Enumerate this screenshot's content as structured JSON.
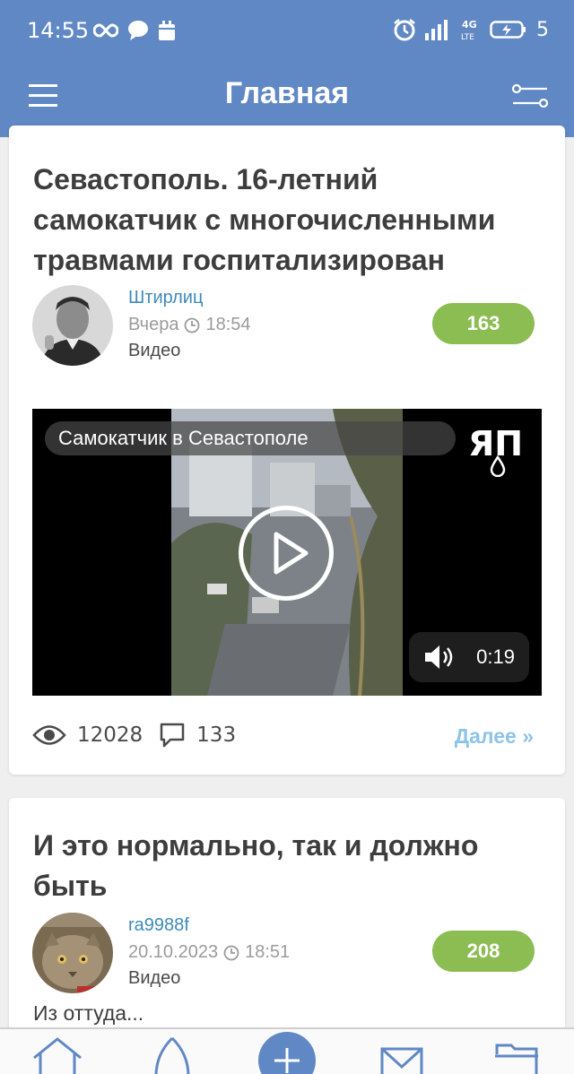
{
  "status_bar": {
    "time": "14:55",
    "network": "4G LTE",
    "battery": "5"
  },
  "app_bar": {
    "title": "Главная"
  },
  "posts": [
    {
      "title": "Севастополь. 16-летний самокатчик с многочисленными травмами госпитализирован",
      "author": "Штирлиц",
      "date": "Вчера",
      "time": "18:54",
      "type": "Видео",
      "rating": "163",
      "video": {
        "caption": "Самокатчик в Севастополе",
        "logo": "ЯП",
        "duration": "0:19"
      },
      "views": "12028",
      "comments": "133",
      "more": "Далее »"
    },
    {
      "title": "И это нормально, так и должно быть",
      "author": "ra9988f",
      "date": "20.10.2023",
      "time": "18:51",
      "type": "Видео",
      "rating": "208",
      "excerpt": "Из оттуда..."
    }
  ],
  "bottom_nav": {
    "items": [
      "home-icon",
      "egg-icon",
      "plus-icon",
      "mail-icon",
      "folder-icon"
    ]
  },
  "colors": {
    "primary": "#5f88c5",
    "rating": "#8cbd52",
    "link": "#3f8ab8",
    "more": "#8cc3e8"
  }
}
